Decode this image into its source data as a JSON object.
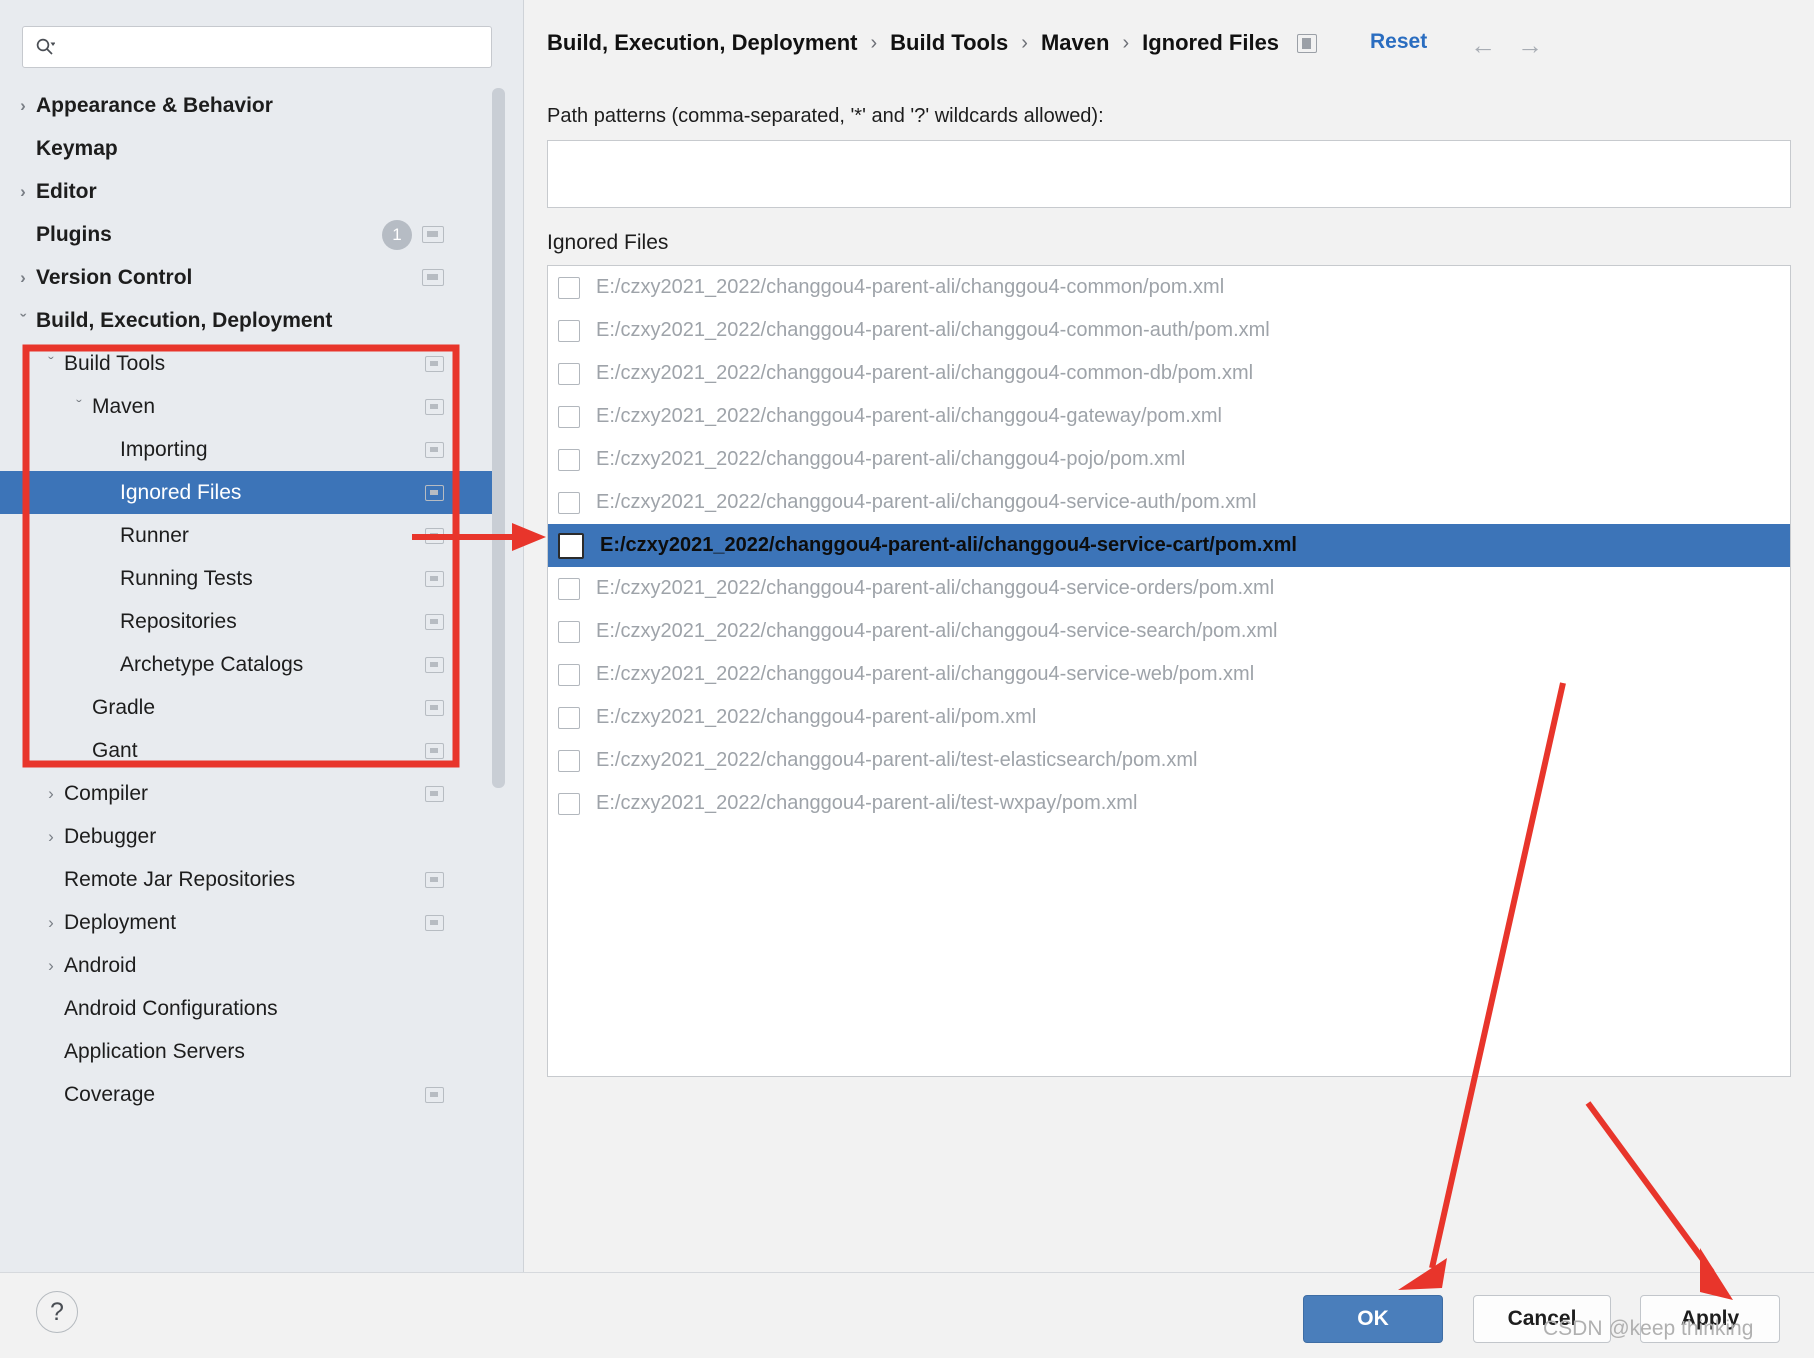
{
  "search": {
    "value": "",
    "placeholder": "",
    "icon": "search-icon"
  },
  "sidebar": {
    "items": [
      {
        "label": "Appearance & Behavior",
        "twist": "›",
        "bold": true,
        "indent": 0,
        "badge": "",
        "copy": false
      },
      {
        "label": "Keymap",
        "twist": "",
        "bold": true,
        "indent": 0,
        "badge": "",
        "copy": false
      },
      {
        "label": "Editor",
        "twist": "›",
        "bold": true,
        "indent": 0,
        "badge": "",
        "copy": false
      },
      {
        "label": "Plugins",
        "twist": "",
        "bold": true,
        "indent": 0,
        "badge": "1",
        "copy": true
      },
      {
        "label": "Version Control",
        "twist": "›",
        "bold": true,
        "indent": 0,
        "badge": "",
        "copy": true
      },
      {
        "label": "Build, Execution, Deployment",
        "twist": "⌄",
        "bold": true,
        "indent": 0,
        "badge": "",
        "copy": false
      },
      {
        "label": "Build Tools",
        "twist": "⌄",
        "bold": false,
        "indent": 1,
        "badge": "",
        "copy": true
      },
      {
        "label": "Maven",
        "twist": "⌄",
        "bold": false,
        "indent": 2,
        "badge": "",
        "copy": true
      },
      {
        "label": "Importing",
        "twist": "",
        "bold": false,
        "indent": 3,
        "badge": "",
        "copy": true
      },
      {
        "label": "Ignored Files",
        "twist": "",
        "bold": false,
        "indent": 3,
        "badge": "",
        "copy": true,
        "selected": true
      },
      {
        "label": "Runner",
        "twist": "",
        "bold": false,
        "indent": 3,
        "badge": "",
        "copy": true
      },
      {
        "label": "Running Tests",
        "twist": "",
        "bold": false,
        "indent": 3,
        "badge": "",
        "copy": true
      },
      {
        "label": "Repositories",
        "twist": "",
        "bold": false,
        "indent": 3,
        "badge": "",
        "copy": true
      },
      {
        "label": "Archetype Catalogs",
        "twist": "",
        "bold": false,
        "indent": 3,
        "badge": "",
        "copy": true
      },
      {
        "label": "Gradle",
        "twist": "",
        "bold": false,
        "indent": 2,
        "badge": "",
        "copy": true
      },
      {
        "label": "Gant",
        "twist": "",
        "bold": false,
        "indent": 2,
        "badge": "",
        "copy": true
      },
      {
        "label": "Compiler",
        "twist": "›",
        "bold": false,
        "indent": 1,
        "badge": "",
        "copy": true
      },
      {
        "label": "Debugger",
        "twist": "›",
        "bold": false,
        "indent": 1,
        "badge": "",
        "copy": false
      },
      {
        "label": "Remote Jar Repositories",
        "twist": "",
        "bold": false,
        "indent": 1,
        "badge": "",
        "copy": true
      },
      {
        "label": "Deployment",
        "twist": "›",
        "bold": false,
        "indent": 1,
        "badge": "",
        "copy": true
      },
      {
        "label": "Android",
        "twist": "›",
        "bold": false,
        "indent": 1,
        "badge": "",
        "copy": false
      },
      {
        "label": "Android Configurations",
        "twist": "",
        "bold": false,
        "indent": 1,
        "badge": "",
        "copy": false
      },
      {
        "label": "Application Servers",
        "twist": "",
        "bold": false,
        "indent": 1,
        "badge": "",
        "copy": false
      },
      {
        "label": "Coverage",
        "twist": "",
        "bold": false,
        "indent": 1,
        "badge": "",
        "copy": true
      }
    ]
  },
  "header": {
    "breadcrumb": [
      "Build, Execution, Deployment",
      "Build Tools",
      "Maven",
      "Ignored Files"
    ],
    "separator": "›",
    "copy_icon": "copy-settings-icon",
    "reset_label": "Reset",
    "back_icon": "←",
    "forward_icon": "→"
  },
  "main": {
    "path_patterns_label": "Path patterns (comma-separated, '*' and '?' wildcards allowed):",
    "path_patterns_value": "",
    "path_patterns_placeholder": "",
    "ignored_files_label": "Ignored Files",
    "files": [
      {
        "path": "E:/czxy2021_2022/changgou4-parent-ali/changgou4-common/pom.xml",
        "checked": false,
        "selected": false
      },
      {
        "path": "E:/czxy2021_2022/changgou4-parent-ali/changgou4-common-auth/pom.xml",
        "checked": false,
        "selected": false
      },
      {
        "path": "E:/czxy2021_2022/changgou4-parent-ali/changgou4-common-db/pom.xml",
        "checked": false,
        "selected": false
      },
      {
        "path": "E:/czxy2021_2022/changgou4-parent-ali/changgou4-gateway/pom.xml",
        "checked": false,
        "selected": false
      },
      {
        "path": "E:/czxy2021_2022/changgou4-parent-ali/changgou4-pojo/pom.xml",
        "checked": false,
        "selected": false
      },
      {
        "path": "E:/czxy2021_2022/changgou4-parent-ali/changgou4-service-auth/pom.xml",
        "checked": false,
        "selected": false
      },
      {
        "path": "E:/czxy2021_2022/changgou4-parent-ali/changgou4-service-cart/pom.xml",
        "checked": false,
        "selected": true
      },
      {
        "path": "E:/czxy2021_2022/changgou4-parent-ali/changgou4-service-orders/pom.xml",
        "checked": false,
        "selected": false
      },
      {
        "path": "E:/czxy2021_2022/changgou4-parent-ali/changgou4-service-search/pom.xml",
        "checked": false,
        "selected": false
      },
      {
        "path": "E:/czxy2021_2022/changgou4-parent-ali/changgou4-service-web/pom.xml",
        "checked": false,
        "selected": false
      },
      {
        "path": "E:/czxy2021_2022/changgou4-parent-ali/pom.xml",
        "checked": false,
        "selected": false
      },
      {
        "path": "E:/czxy2021_2022/changgou4-parent-ali/test-elasticsearch/pom.xml",
        "checked": false,
        "selected": false
      },
      {
        "path": "E:/czxy2021_2022/changgou4-parent-ali/test-wxpay/pom.xml",
        "checked": false,
        "selected": false
      }
    ]
  },
  "footer": {
    "help_label": "?",
    "ok_label": "OK",
    "cancel_label": "Cancel",
    "apply_label": "Apply"
  },
  "watermark": {
    "text": "CSDN @keep thinking"
  },
  "colors": {
    "selection_blue": "#3c74b8",
    "accent_link": "#2a6dc0",
    "annotation_red": "#e8352b",
    "sidebar_bg": "#e8ebef",
    "panel_bg": "#f2f2f2"
  }
}
